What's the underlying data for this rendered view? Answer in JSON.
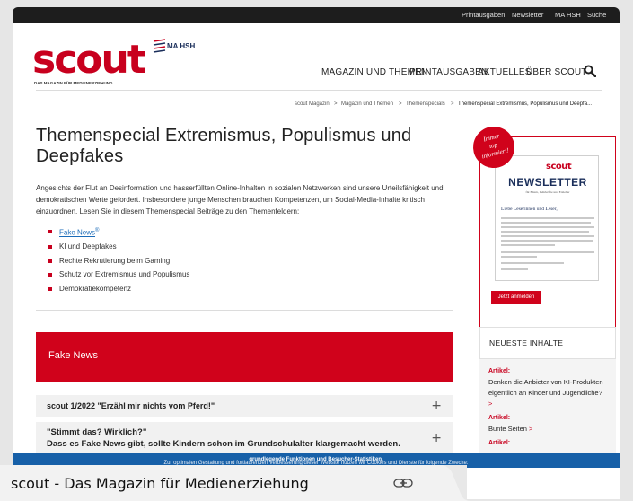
{
  "topbar": {
    "links": [
      "Printausgaben",
      "Newsletter",
      "MA HSH",
      "Suche"
    ]
  },
  "logo": {
    "wordmark": "scout",
    "badge": "MA HSH",
    "tagline": "DAS MAGAZIN FÜR MEDIENERZIEHUNG"
  },
  "nav": {
    "items": [
      "MAGAZIN UND THEMEN",
      "PRINTAUSGABEN",
      "AKTUELLES",
      "ÜBER SCOUT"
    ]
  },
  "breadcrumb": {
    "items": [
      "scout Magazin",
      "Magazin und Themen",
      "Themenspecials"
    ],
    "separator": ">",
    "current": "Themenspecial Extremismus, Populismus und Deepfa..."
  },
  "article": {
    "title": "Themenspecial Extremismus, Populismus und Deepfakes",
    "intro": "Angesichts der Flut an Desinformation und hasserfüllten Online-Inhalten in sozialen Netzwerken sind unsere Urteilsfähigkeit und demokratischen Werte gefordert. Insbesondere junge Menschen brauchen Kompetenzen, um Social-Media-Inhalte kritisch einzuordnen. Lesen Sie in diesem Themenspecial Beiträge zu den Themenfeldern:",
    "topics": [
      "Fake News",
      "KI und Deepfakes",
      "Rechte Rekrutierung beim Gaming",
      "Schutz vor Extremismus und Populismus",
      "Demokratiekompetenz"
    ],
    "topic_link_mark": "®"
  },
  "section": {
    "banner": "Fake News",
    "accordion": [
      {
        "title": "scout 1/2022 \"Erzähl mir nichts vom Pferd!\"",
        "toggle": "+"
      },
      {
        "title": "\"Stimmt das? Wirklich?\"",
        "subtitle": "Dass es Fake News gibt, sollte Kindern schon im Grundschulalter klargemacht werden.",
        "toggle": "+"
      }
    ]
  },
  "promo": {
    "stamp": [
      "Immer",
      "top",
      "informiert!"
    ],
    "newsletter_logo": "scout",
    "newsletter_title": "NEWSLETTER",
    "newsletter_subtitle": "für Eltern, Lehrkräfte und Erzieher",
    "greeting": "Liebe Leserinnen und Leser,",
    "button": "Jetzt anmelden"
  },
  "sidebar": {
    "heading": "NEUESTE INHALTE",
    "items": [
      {
        "label": "Artikel:",
        "text": "Denken die Anbieter von KI-Produkten eigentlich an Kinder und Jugendliche?",
        "arrow": ">"
      },
      {
        "label": "Artikel:",
        "text": "Bunte Seiten",
        "arrow": ">"
      },
      {
        "label": "Artikel:",
        "text": "",
        "arrow": ""
      }
    ]
  },
  "cookie": {
    "text": "Zur optimalen Gestaltung und fortlaufenden Verbesserung dieser Website nutzen wir Cookies und Dienste für folgende Zwecke: ",
    "strong": "grundlegende Funktionen und Besucher-Statistiken."
  },
  "tab": {
    "title": "scout - Das Magazin für Medienerziehung"
  },
  "colors": {
    "brand_red": "#c8001e",
    "cookie_blue": "#1760a8",
    "navy": "#1a2e5a"
  }
}
